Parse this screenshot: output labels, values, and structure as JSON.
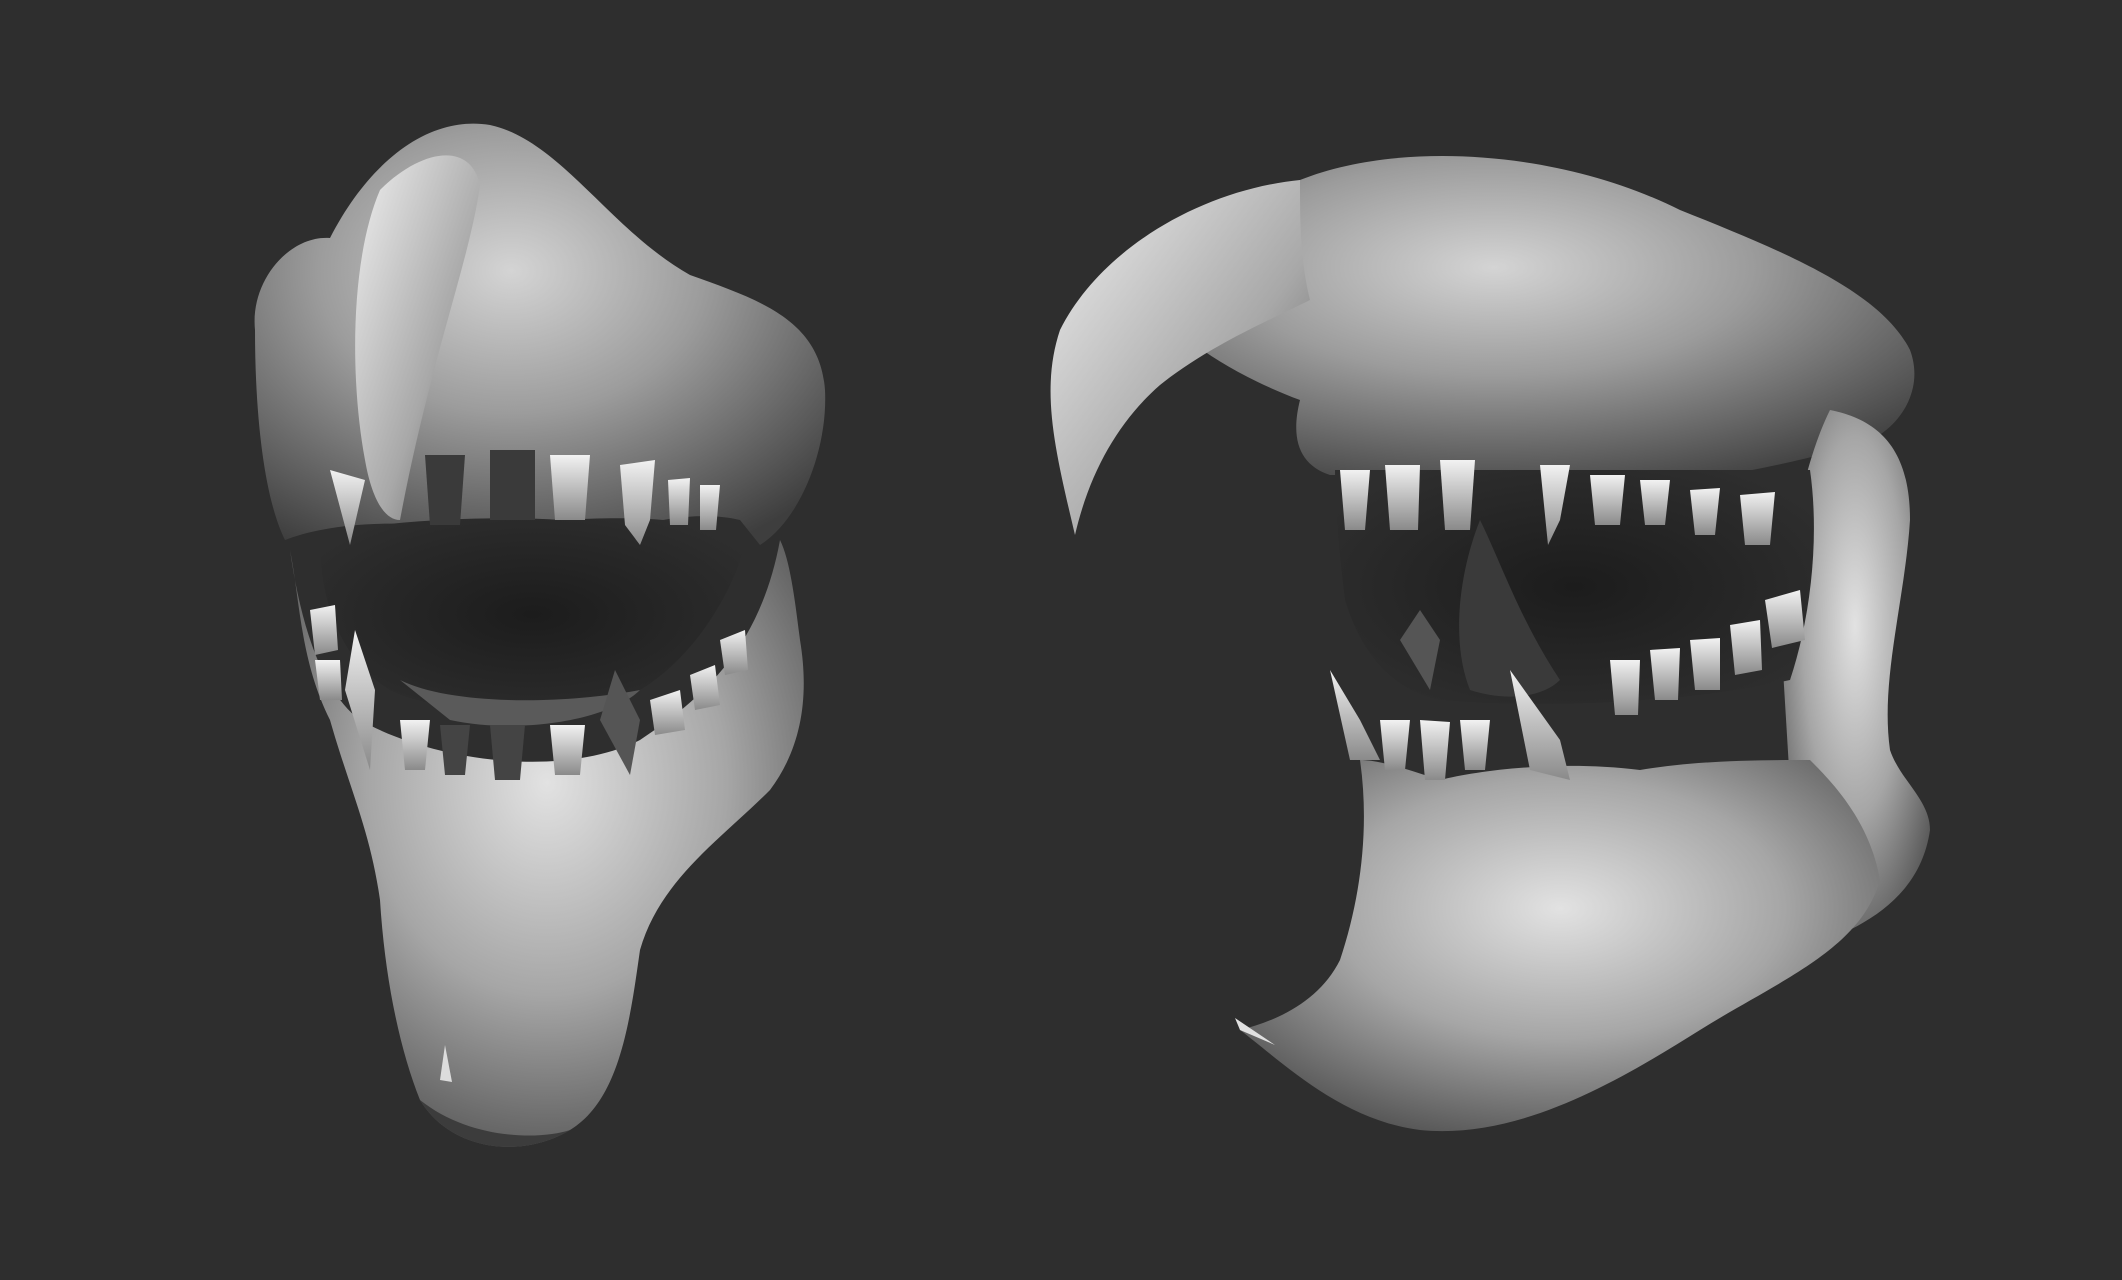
{
  "scene": {
    "background_color": "#2e2e2e",
    "material_color": "#9a9a9a",
    "models": [
      {
        "name": "jaw-front-view",
        "view": "front"
      },
      {
        "name": "jaw-three-quarter-view",
        "view": "three-quarter"
      }
    ]
  }
}
